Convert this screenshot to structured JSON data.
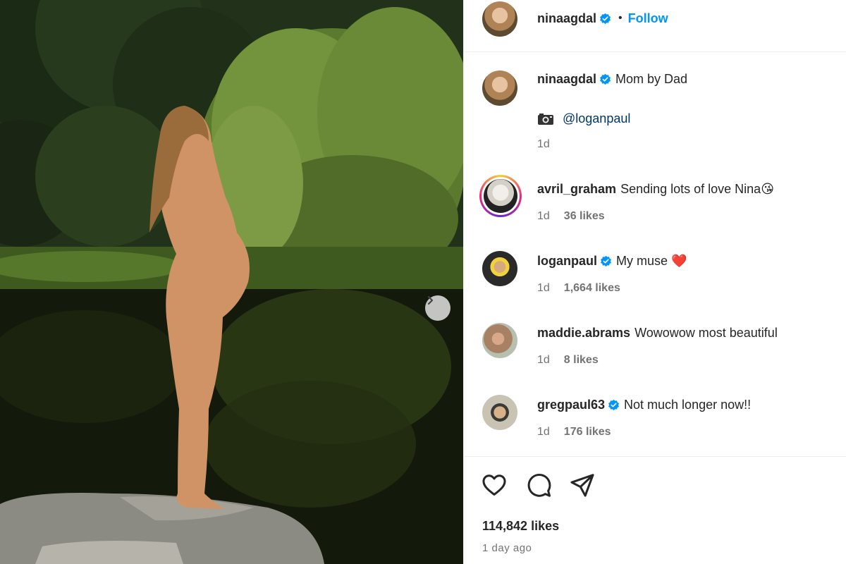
{
  "post": {
    "author": "ninaagdal",
    "follow_label": "Follow",
    "dot": "•",
    "caption": "Mom by Dad",
    "caption_mention": "@loganpaul",
    "caption_time": "1d",
    "likes": "114,842 likes",
    "time_ago": "1 day ago"
  },
  "comments": [
    {
      "user": "avril_graham",
      "verified": false,
      "text": "Sending lots of love Nina😘",
      "time": "1d",
      "likes": "36 likes"
    },
    {
      "user": "loganpaul",
      "verified": true,
      "text": "My muse ❤️",
      "time": "1d",
      "likes": "1,664 likes"
    },
    {
      "user": "maddie.abrams",
      "verified": false,
      "text": "Wowowow most beautiful",
      "time": "1d",
      "likes": "8 likes"
    },
    {
      "user": "gregpaul63",
      "verified": true,
      "text": "Not much longer now!!",
      "time": "1d",
      "likes": "176 likes"
    }
  ],
  "icons": {
    "verified": "verified-badge-icon",
    "next": "chevron-right-icon",
    "like": "heart-icon",
    "comment": "comment-icon",
    "share": "share-icon",
    "camera": "camera-icon"
  },
  "colors": {
    "link": "#0095f6",
    "mention": "#00376b",
    "verified": "#0095f6",
    "muted": "#737373"
  }
}
